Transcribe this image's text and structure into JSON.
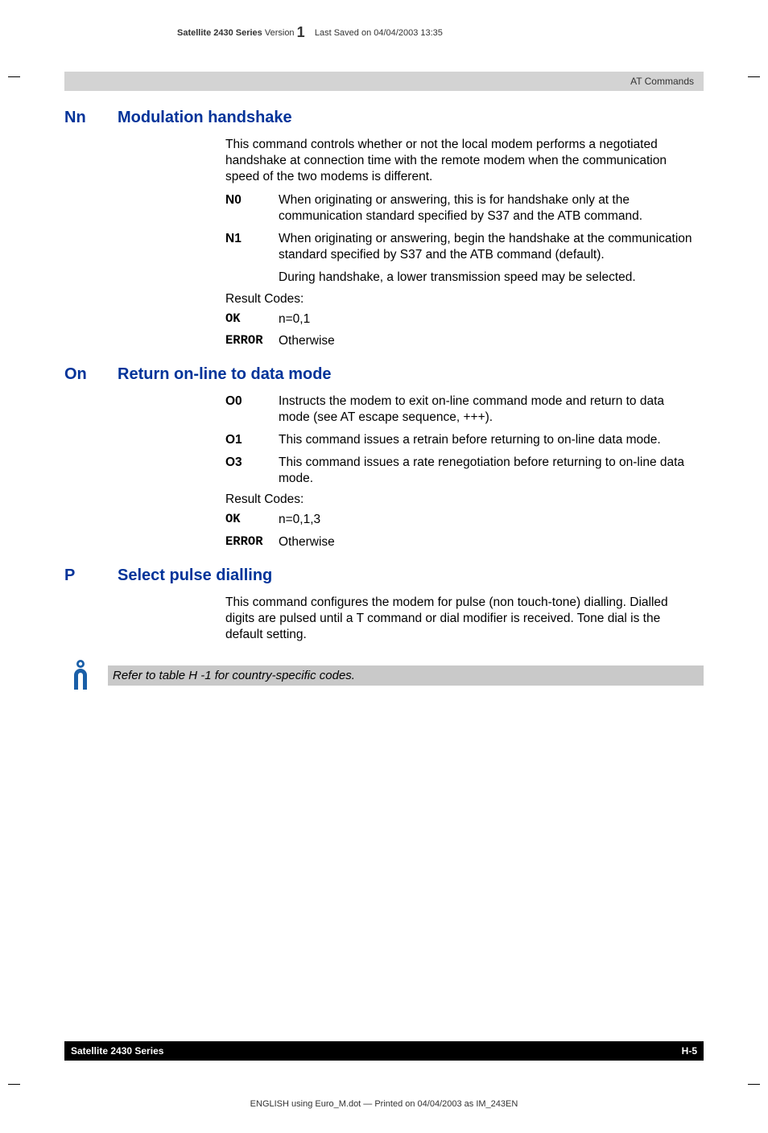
{
  "doc_header": {
    "series_bold": "Satellite 2430 Series",
    "version_word": "Version",
    "version_num": "1",
    "saved": "Last Saved on 04/04/2003 13:35"
  },
  "section_tab": "AT Commands",
  "sections": {
    "nn": {
      "code": "Nn",
      "title": "Modulation handshake",
      "intro": "This command controls whether or not the local modem performs a negotiated handshake at connection time with the remote modem when the communication speed of the two modems is different.",
      "items": [
        {
          "tag": "N0",
          "text": "When originating or answering, this is for handshake only at the communication standard specified by S37 and the ATB command."
        },
        {
          "tag": "N1",
          "text": "When originating or answering, begin the handshake at the communication standard specified by S37 and the ATB command (default)."
        }
      ],
      "extra": "During handshake, a lower transmission speed may be selected.",
      "result_label": "Result Codes:",
      "results": [
        {
          "tag": "OK",
          "text": "n=0,1"
        },
        {
          "tag": "ERROR",
          "text": "Otherwise"
        }
      ]
    },
    "on": {
      "code": "On",
      "title": "Return on-line to data mode",
      "items": [
        {
          "tag": "O0",
          "text": "Instructs the modem to exit on-line command mode and return to data mode (see AT escape sequence, +++)."
        },
        {
          "tag": "O1",
          "text": "This command issues a retrain before returning to on-line data mode."
        },
        {
          "tag": "O3",
          "text": "This command issues a rate renegotiation before returning to on-line data mode."
        }
      ],
      "result_label": "Result Codes:",
      "results": [
        {
          "tag": "OK",
          "text": "n=0,1,3"
        },
        {
          "tag": "ERROR",
          "text": "Otherwise"
        }
      ]
    },
    "p": {
      "code": "P",
      "title": "Select pulse dialling",
      "intro": "This command configures the modem for pulse (non touch-tone) dialling. Dialled digits are pulsed until a T command or dial modifier is received. Tone dial is the default setting."
    }
  },
  "note_text": "Refer to table H -1 for country-specific codes.",
  "footer": {
    "left": "Satellite 2430 Series",
    "right": "H-5"
  },
  "print_line": "ENGLISH using  Euro_M.dot — Printed on 04/04/2003 as IM_243EN"
}
